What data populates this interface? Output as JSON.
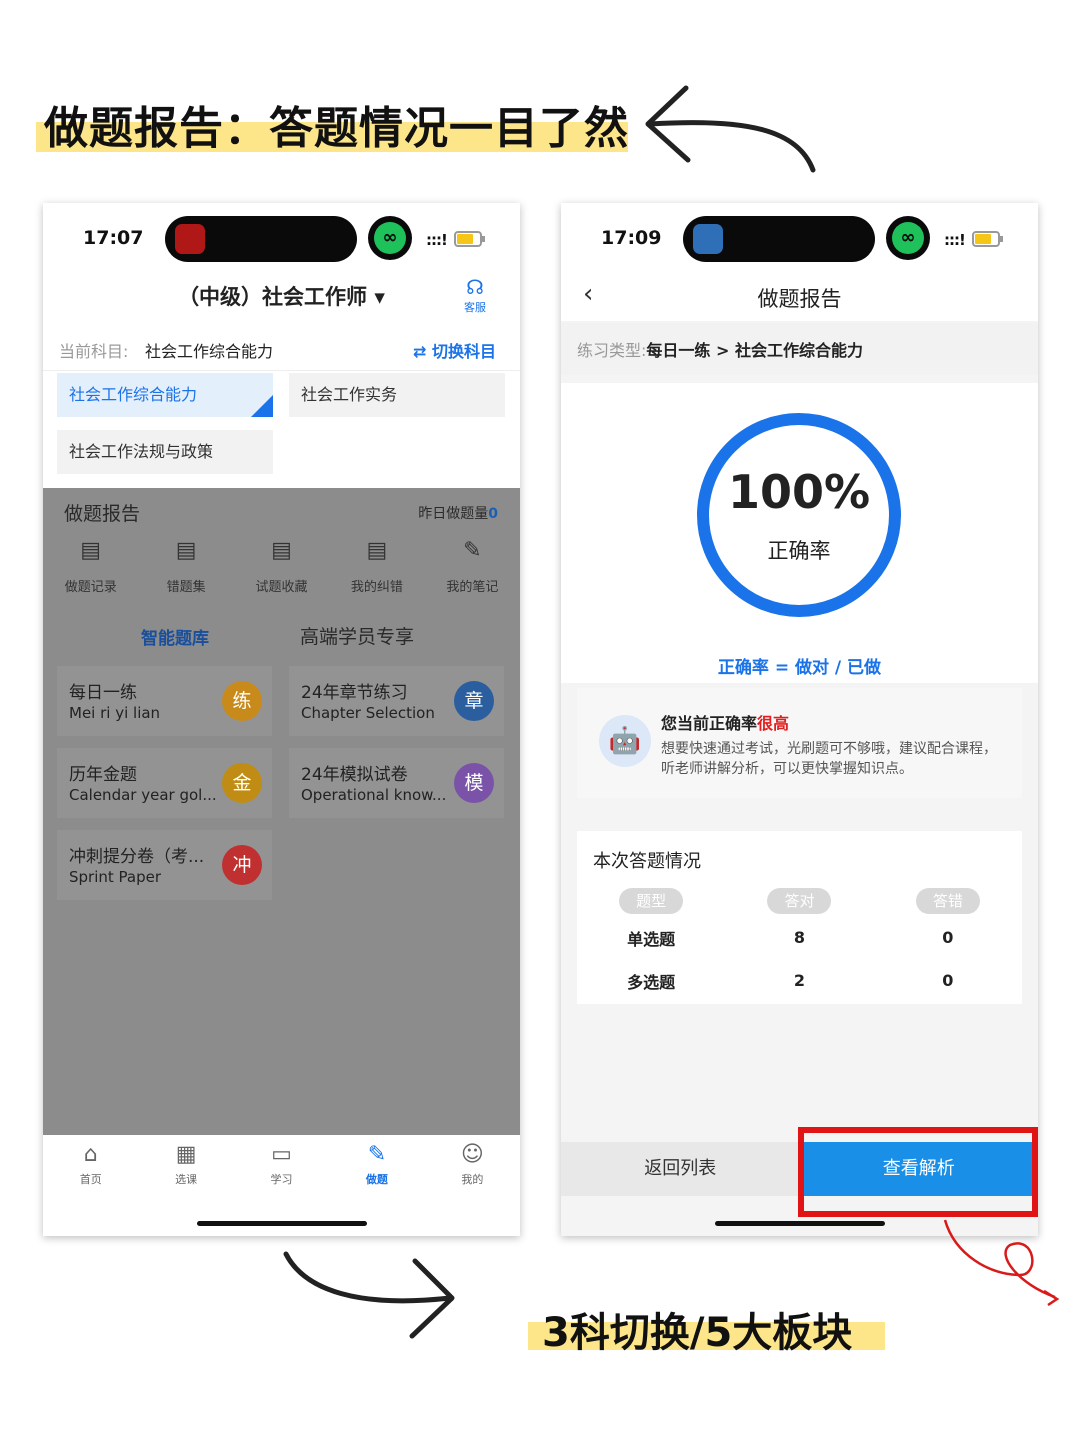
{
  "headline": {
    "text": "做题报告：答题情况一目了然"
  },
  "bottom_caption": {
    "text": "3科切换/5大板块"
  },
  "colors": {
    "accent": "#1a73e8",
    "highlight": "#fde68a",
    "warning": "#e02020",
    "annotation": "#e01414"
  },
  "left_phone": {
    "status": {
      "time": "17:07",
      "signal": ":::!"
    },
    "title": "（中级）社会工作师 ▾",
    "service_label": "客服",
    "service_icon": "headset-icon",
    "subject_label": "当前科目:",
    "subject_value": "社会工作综合能力",
    "switch_label": "⇄ 切换科目",
    "subjects": [
      "社会工作综合能力",
      "社会工作实务",
      "社会工作法规与政策"
    ],
    "report_title": "做题报告",
    "yesterday_label": "昨日做题量",
    "yesterday_count": "0",
    "tools": [
      {
        "icon": "record-icon",
        "label": "做题记录"
      },
      {
        "icon": "wrong-set-icon",
        "label": "错题集"
      },
      {
        "icon": "favorite-icon",
        "label": "试题收藏"
      },
      {
        "icon": "correction-icon",
        "label": "我的纠错"
      },
      {
        "icon": "note-icon",
        "label": "我的笔记"
      }
    ],
    "lib_tab_active": "智能题库",
    "lib_tab_other": "高端学员专享",
    "cards": [
      {
        "title": "每日一练",
        "subtitle": "Mei ri yi lian",
        "badge": "练",
        "color": "#f0a020"
      },
      {
        "title": "24年章节练习",
        "subtitle": "Chapter Selection",
        "badge": "章",
        "color": "#2e7cd6"
      },
      {
        "title": "历年金题",
        "subtitle": "Calendar year gol...",
        "badge": "金",
        "color": "#e0a010"
      },
      {
        "title": "24年模拟试卷",
        "subtitle": "Operational know...",
        "badge": "模",
        "color": "#8e5bd0"
      },
      {
        "title": "冲刺提分卷（考...",
        "subtitle": "Sprint Paper",
        "badge": "冲",
        "color": "#e03a3a"
      }
    ],
    "tabbar": [
      {
        "icon": "home-icon",
        "label": "首页"
      },
      {
        "icon": "course-icon",
        "label": "选课"
      },
      {
        "icon": "book-icon",
        "label": "学习"
      },
      {
        "icon": "quiz-icon",
        "label": "做题"
      },
      {
        "icon": "user-icon",
        "label": "我的"
      }
    ]
  },
  "right_phone": {
    "status": {
      "time": "17:09",
      "signal": ":::!"
    },
    "title": "做题报告",
    "crumb_key": "练习类型:",
    "crumb_value": "每日一练 > 社会工作综合能力",
    "accuracy": "100%",
    "accuracy_label": "正确率",
    "accuracy_fraction": 1.0,
    "formula": "正确率 = 做对 / 已做",
    "tip_title": "您当前正确率",
    "tip_level": "很高",
    "tip_body": "想要快速通过考试，光刷题可不够哦，建议配合课程，听老师讲解分析，可以更快掌握知识点。",
    "stats_title": "本次答题情况",
    "stats_headers": [
      "题型",
      "答对",
      "答错"
    ],
    "stats_rows": [
      [
        "单选题",
        "8",
        "0"
      ],
      [
        "多选题",
        "2",
        "0"
      ]
    ],
    "back_label": "返回列表",
    "view_label": "查看解析"
  }
}
